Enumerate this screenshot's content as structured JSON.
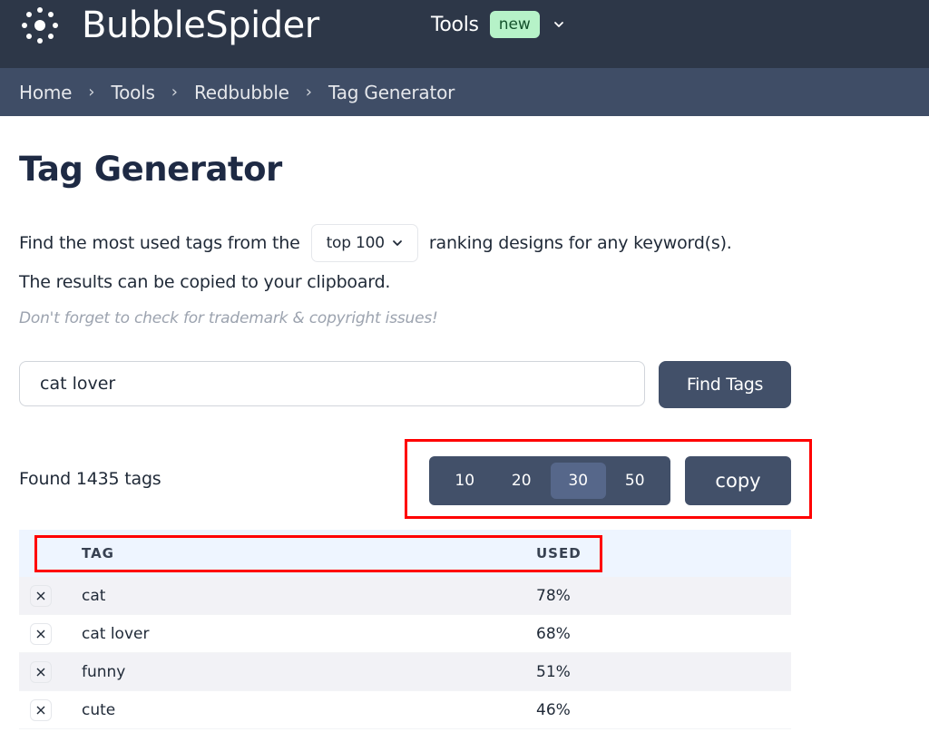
{
  "header": {
    "brand": "BubbleSpider",
    "nav_tools_label": "Tools",
    "nav_badge": "new",
    "logo_icon": "bubble-dots-logo",
    "chevron_icon": "chevron-down-icon"
  },
  "breadcrumb": [
    {
      "label": "Home"
    },
    {
      "label": "Tools"
    },
    {
      "label": "Redbubble"
    },
    {
      "label": "Tag Generator"
    }
  ],
  "breadcrumb_separator": "›",
  "main": {
    "title": "Tag Generator",
    "desc_prefix": "Find the most used tags from the",
    "desc_suffix": "ranking designs for any keyword(s).",
    "ranking_select": {
      "selected": "top 100"
    },
    "desc_line2": "The results can be copied to your clipboard.",
    "warning": "Don't forget to check for trademark & copyright issues!",
    "search": {
      "value": "cat lover",
      "placeholder": ""
    },
    "find_button": "Find Tags",
    "found_text": "Found 1435 tags",
    "count_options": [
      "10",
      "20",
      "30",
      "50"
    ],
    "count_selected": "30",
    "copy_button": "copy"
  },
  "table": {
    "headers": {
      "tag": "TAG",
      "used": "USED"
    },
    "rows": [
      {
        "tag": "cat",
        "used": "78%"
      },
      {
        "tag": "cat lover",
        "used": "68%"
      },
      {
        "tag": "funny",
        "used": "51%"
      },
      {
        "tag": "cute",
        "used": "46%"
      }
    ],
    "remove_icon": "close-icon"
  },
  "colors": {
    "header_bg": "#2d3748",
    "breadcrumb_bg": "#3f4d66",
    "button_bg": "#425069",
    "active_option_bg": "#56678a",
    "badge_bg": "#b6f2c8",
    "highlight": "#ff0000",
    "table_header_bg": "#eef5ff"
  }
}
